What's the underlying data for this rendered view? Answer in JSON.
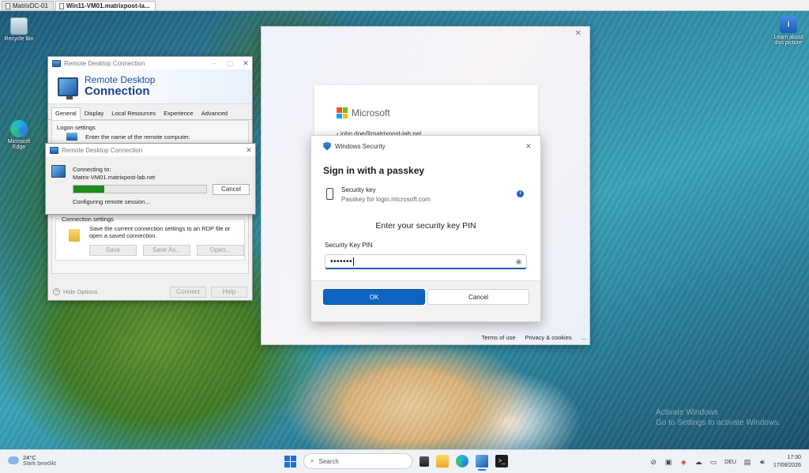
{
  "tabs": [
    {
      "label": "MatrixDC-01",
      "active": false
    },
    {
      "label": "Win11-VM01.matrixpost-la...",
      "active": true
    }
  ],
  "desktop_icons": {
    "recycle_bin": "Recycle Bin",
    "edge": "Microsoft Edge",
    "learn": "Learn about this picture"
  },
  "rdc_main": {
    "title": "Remote Desktop Connection",
    "banner_line1": "Remote Desktop",
    "banner_line2": "Connection",
    "tabs": [
      "General",
      "Display",
      "Local Resources",
      "Experience",
      "Advanced"
    ],
    "logon_settings_label": "Logon settings",
    "logon_hint": "Enter the name of the remote computer.",
    "connection_settings_label": "Connection settings",
    "connection_hint": "Save the current connection settings to an RDP file or open a saved connection.",
    "save": "Save",
    "save_as": "Save As...",
    "open": "Open...",
    "hide_options": "Hide Options",
    "connect": "Connect",
    "help": "Help"
  },
  "rdc_progress": {
    "title": "Remote Desktop Connection",
    "connecting_to": "Connecting to:",
    "host": "Matrix-VM01.matrixpost-lab.net",
    "status": "Configuring remote session...",
    "cancel": "Cancel",
    "progress_fraction": 0.23
  },
  "ms_signin": {
    "brand": "Microsoft",
    "email": "john.doe@matrixpost-lab.net",
    "terms": "Terms of use",
    "privacy": "Privacy & cookies",
    "more": "..."
  },
  "windows_security": {
    "header": "Windows Security",
    "title": "Sign in with a passkey",
    "key_name": "Security key",
    "key_desc": "Passkey for login.microsoft.com",
    "pin_heading": "Enter your security key PIN",
    "pin_label": "Security Key PIN",
    "pin_value": "•••••••",
    "ok": "OK",
    "cancel": "Cancel"
  },
  "taskbar": {
    "temperature": "24°C",
    "weather": "Stark bewölkt",
    "search_placeholder": "Search",
    "language": "DEU",
    "time": "17:30",
    "date": "17/08/2026"
  },
  "watermark": {
    "line1": "Activate Windows",
    "line2": "Go to Settings to activate Windows."
  },
  "colors": {
    "accent": "#0f64c0",
    "progress": "#1f8a1f"
  }
}
